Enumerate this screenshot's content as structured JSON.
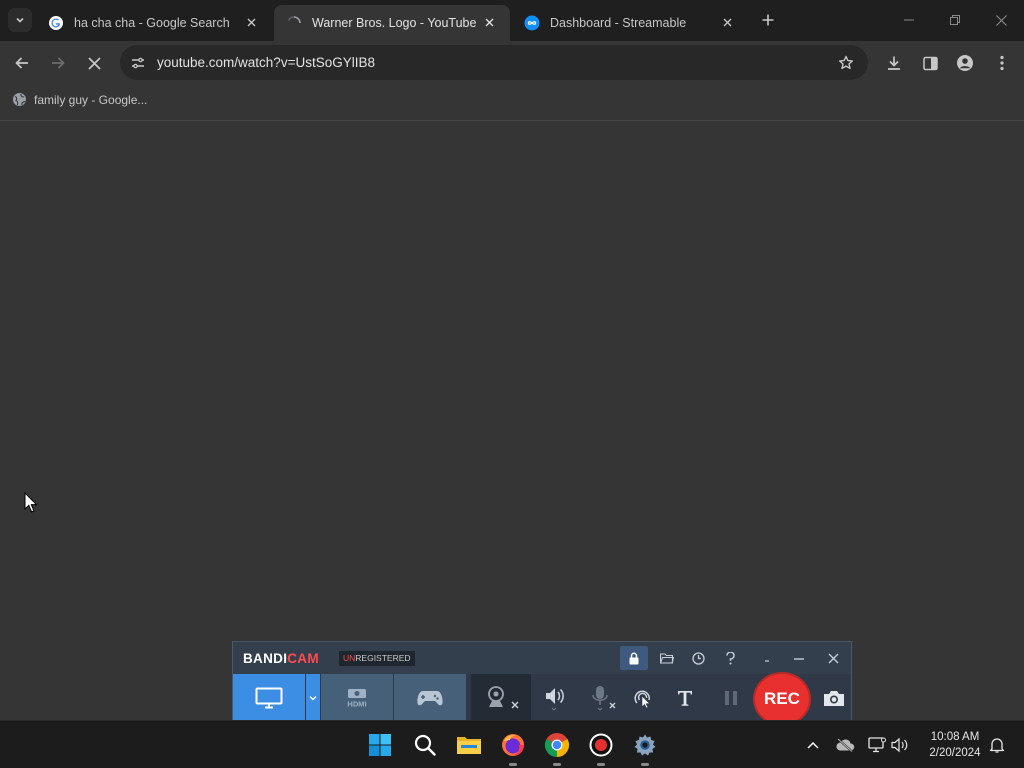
{
  "browser": {
    "tabs": [
      {
        "title": "ha cha cha - Google Search",
        "icon": "google-icon",
        "active": false
      },
      {
        "title": "Warner Bros. Logo - YouTube",
        "icon": "loading-spinner-icon",
        "active": true
      },
      {
        "title": "Dashboard - Streamable",
        "icon": "streamable-icon",
        "active": false
      }
    ],
    "url": "youtube.com/watch?v=UstSoGYlIB8",
    "bookmarks": [
      {
        "label": "family guy - Google...",
        "icon": "globe-icon"
      }
    ]
  },
  "bandicam": {
    "logo_bandi": "BANDI",
    "logo_cam": "CAM",
    "unregistered_un": "UN",
    "unregistered_rest": "REGISTERED",
    "rec_label": "REC",
    "brand_color": "#ff4b4b",
    "accent_color": "#3b8ee3"
  },
  "taskbar": {
    "apps": [
      "start-icon",
      "search-icon",
      "file-explorer-icon",
      "firefox-icon",
      "chrome-icon",
      "bandicam-record-icon",
      "settings-icon"
    ],
    "time": "10:08 AM",
    "date": "2/20/2024"
  },
  "colors": {
    "page_background": "#353535",
    "tabbar_background": "#1f1f1f",
    "taskbar_background": "#1c1c1c"
  }
}
